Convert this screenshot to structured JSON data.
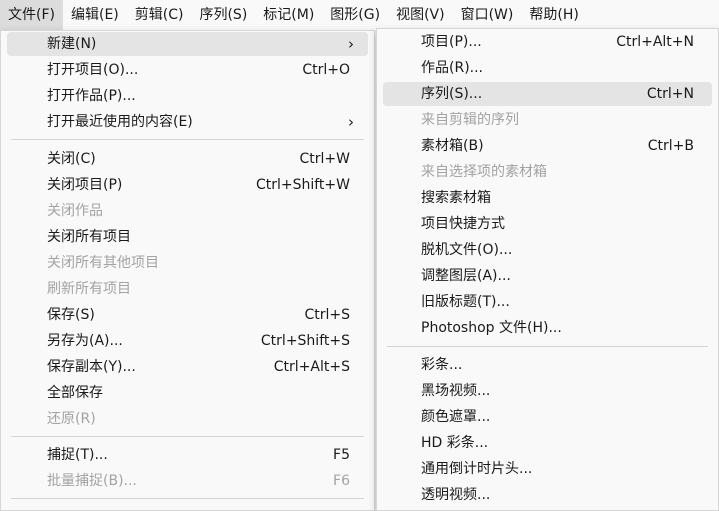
{
  "menubar": [
    {
      "label": "文件(F)"
    },
    {
      "label": "编辑(E)"
    },
    {
      "label": "剪辑(C)"
    },
    {
      "label": "序列(S)"
    },
    {
      "label": "标记(M)"
    },
    {
      "label": "图形(G)"
    },
    {
      "label": "视图(V)"
    },
    {
      "label": "窗口(W)"
    },
    {
      "label": "帮助(H)"
    }
  ],
  "file_menu": {
    "items": [
      {
        "label": "新建(N)",
        "shortcut": "",
        "submenu": true,
        "highlighted": true
      },
      {
        "label": "打开项目(O)...",
        "shortcut": "Ctrl+O"
      },
      {
        "label": "打开作品(P)...",
        "shortcut": ""
      },
      {
        "label": "打开最近使用的内容(E)",
        "shortcut": "",
        "submenu": true
      },
      {
        "label": "关闭(C)",
        "shortcut": "Ctrl+W"
      },
      {
        "label": "关闭项目(P)",
        "shortcut": "Ctrl+Shift+W"
      },
      {
        "label": "关闭作品",
        "shortcut": "",
        "disabled": true
      },
      {
        "label": "关闭所有项目",
        "shortcut": ""
      },
      {
        "label": "关闭所有其他项目",
        "shortcut": "",
        "disabled": true
      },
      {
        "label": "刷新所有项目",
        "shortcut": "",
        "disabled": true
      },
      {
        "label": "保存(S)",
        "shortcut": "Ctrl+S"
      },
      {
        "label": "另存为(A)...",
        "shortcut": "Ctrl+Shift+S"
      },
      {
        "label": "保存副本(Y)...",
        "shortcut": "Ctrl+Alt+S"
      },
      {
        "label": "全部保存",
        "shortcut": ""
      },
      {
        "label": "还原(R)",
        "shortcut": "",
        "disabled": true
      },
      {
        "label": "捕捉(T)...",
        "shortcut": "F5"
      },
      {
        "label": "批量捕捉(B)...",
        "shortcut": "F6",
        "disabled": true
      }
    ]
  },
  "new_submenu": {
    "items": [
      {
        "label": "项目(P)...",
        "shortcut": "Ctrl+Alt+N"
      },
      {
        "label": "作品(R)...",
        "shortcut": ""
      },
      {
        "label": "序列(S)...",
        "shortcut": "Ctrl+N",
        "highlighted": true
      },
      {
        "label": "来自剪辑的序列",
        "shortcut": "",
        "disabled": true
      },
      {
        "label": "素材箱(B)",
        "shortcut": "Ctrl+B"
      },
      {
        "label": "来自选择项的素材箱",
        "shortcut": "",
        "disabled": true
      },
      {
        "label": "搜索素材箱",
        "shortcut": ""
      },
      {
        "label": "项目快捷方式",
        "shortcut": ""
      },
      {
        "label": "脱机文件(O)...",
        "shortcut": ""
      },
      {
        "label": "调整图层(A)...",
        "shortcut": ""
      },
      {
        "label": "旧版标题(T)...",
        "shortcut": ""
      },
      {
        "label": "Photoshop 文件(H)...",
        "shortcut": ""
      },
      {
        "label": "彩条...",
        "shortcut": ""
      },
      {
        "label": "黑场视频...",
        "shortcut": ""
      },
      {
        "label": "颜色遮罩...",
        "shortcut": ""
      },
      {
        "label": "HD 彩条...",
        "shortcut": ""
      },
      {
        "label": "通用倒计时片头...",
        "shortcut": ""
      },
      {
        "label": "透明视频...",
        "shortcut": ""
      }
    ]
  }
}
